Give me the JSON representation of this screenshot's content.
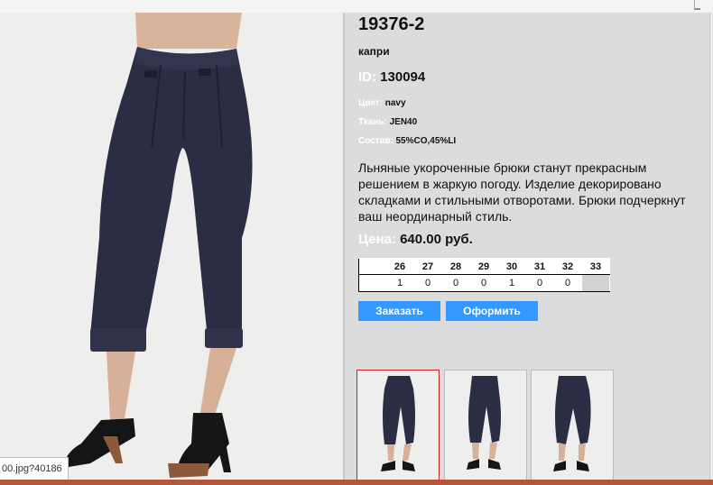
{
  "product": {
    "code": "19376-2",
    "type": "капри",
    "id_label": "ID:",
    "id_value": "130094",
    "attributes": [
      {
        "label": "Цвет:",
        "value": "navy"
      },
      {
        "label": "Ткань:",
        "value": "JEN40"
      },
      {
        "label": "Состав:",
        "value": "55%CO,45%LI"
      }
    ],
    "description": "Льняные укороченные брюки станут прекрасным решением в жаркую погоду. Изделие декорировано складками и стильными отворотами. Брюки подчеркнут ваш неординарный стиль.",
    "price_label": "Цена:",
    "price_value": "640.00 руб."
  },
  "sizes": {
    "headers": [
      "26",
      "27",
      "28",
      "29",
      "30",
      "31",
      "32",
      "33"
    ],
    "quantities": [
      "1",
      "0",
      "0",
      "0",
      "1",
      "0",
      "0",
      ""
    ]
  },
  "buttons": {
    "order": "Заказать",
    "checkout": "Оформить"
  },
  "status_url": "00.jpg?40186",
  "colors": {
    "page_bg": "#dcdcdc",
    "button": "#3399ff",
    "active_thumb_border": "#d21f1f",
    "pants": "#2b2d44",
    "bottom_bar": "#b3563b"
  },
  "images": {
    "main_photo": "navy-capri-pants-photo",
    "thumbnails": [
      "front-view",
      "front-view-alt",
      "back-view"
    ]
  }
}
